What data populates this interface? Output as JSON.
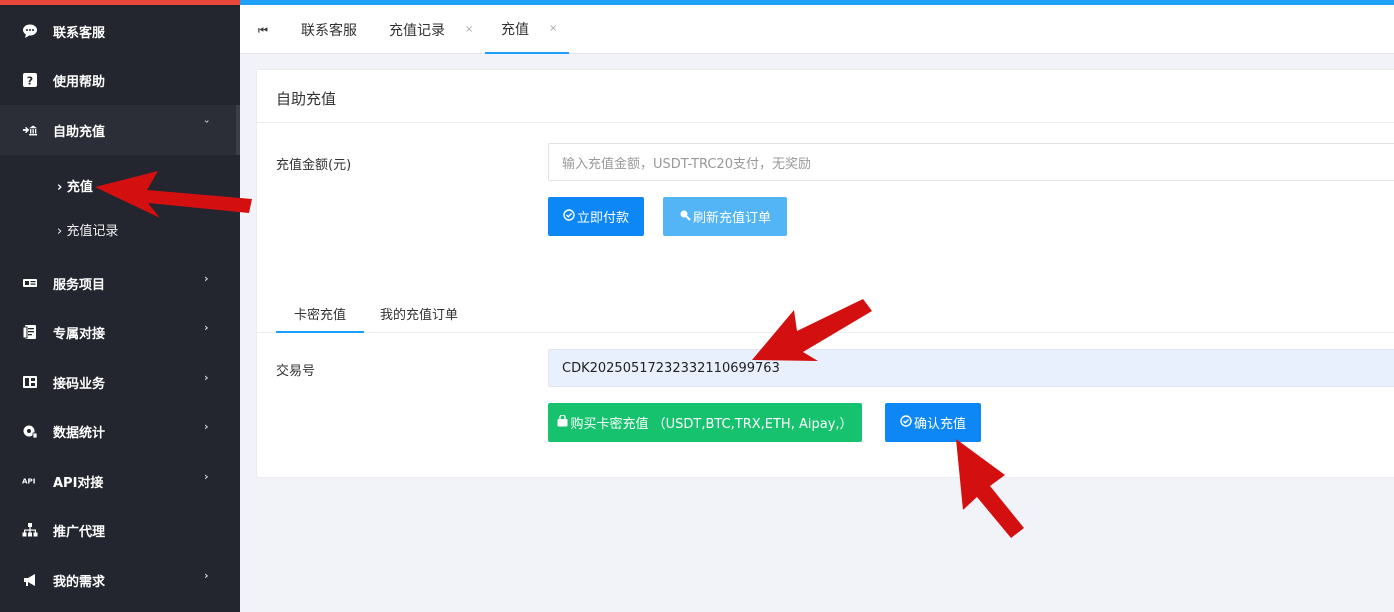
{
  "sidebar": {
    "items": [
      {
        "label": "联系客服",
        "icon": "chat-bubble-icon",
        "has_arrow": false
      },
      {
        "label": "使用帮助",
        "icon": "question-icon",
        "has_arrow": false
      },
      {
        "label": "自助充值",
        "icon": "recharge-icon",
        "has_arrow": true,
        "expanded": true
      },
      {
        "label": "服务项目",
        "icon": "card-list-icon",
        "has_arrow": true
      },
      {
        "label": "专属对接",
        "icon": "contract-icon",
        "has_arrow": true
      },
      {
        "label": "接码业务",
        "icon": "sim-icon",
        "has_arrow": true
      },
      {
        "label": "数据统计",
        "icon": "cog-stats-icon",
        "has_arrow": true
      },
      {
        "label": "API对接",
        "icon": "api-icon",
        "has_arrow": true
      },
      {
        "label": "推广代理",
        "icon": "sitemap-icon",
        "has_arrow": false
      },
      {
        "label": "我的需求",
        "icon": "megaphone-icon",
        "has_arrow": true
      }
    ],
    "sub_items": [
      {
        "label": "充值"
      },
      {
        "label": "充值记录"
      }
    ],
    "arrow_right": "›",
    "arrow_down": "ˇ"
  },
  "tabs": {
    "first_icon": "⏮",
    "items": [
      {
        "label": "联系客服",
        "closable": false
      },
      {
        "label": "充值记录",
        "closable": true
      },
      {
        "label": "充值",
        "closable": true,
        "active": true
      }
    ],
    "close_glyph": "×"
  },
  "card": {
    "title": "自助充值",
    "amount_label": "充值金额(元)",
    "amount_placeholder": "输入充值金额，USDT-TRC20支付，无奖励",
    "pay_button": "立即付款",
    "refresh_button": "刷新充值订单",
    "subtabs": [
      "卡密充值",
      "我的充值订单"
    ],
    "txn_label": "交易号",
    "txn_value": "CDK20250517232332110699763",
    "buy_button": "购买卡密充值 （USDT,BTC,TRX,ETH, Aipay,）",
    "confirm_button": "确认充值"
  },
  "colors": {
    "sidebar_bg": "#23262e",
    "accent_blue": "#0d87f5",
    "light_blue": "#54b5f6",
    "green": "#17c26e",
    "annotation_red": "#d40f0f"
  }
}
